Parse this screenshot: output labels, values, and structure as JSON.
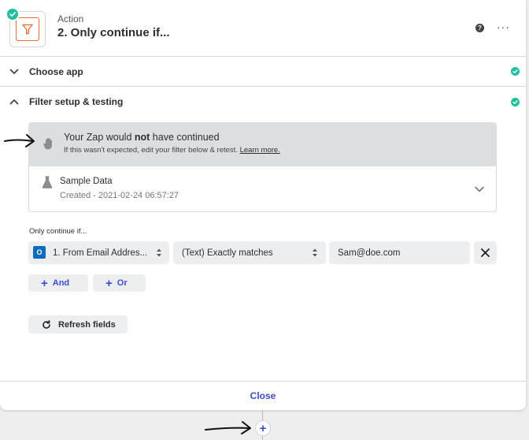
{
  "header": {
    "step_kind": "Action",
    "step_title": "2. Only continue if...",
    "help_glyph": "?",
    "more_glyph": "···"
  },
  "sections": [
    {
      "label": "Choose app",
      "expanded": false,
      "complete": true
    },
    {
      "label": "Filter setup & testing",
      "expanded": true,
      "complete": true
    }
  ],
  "alert": {
    "title_prefix": "Your Zap would ",
    "title_emphasis": "not",
    "title_suffix": " have continued",
    "subtitle": "If this wasn't expected, edit your filter below & retest.",
    "learn_more": "Learn more."
  },
  "sample": {
    "title": "Sample Data",
    "created": "Created - 2021-02-24 06:57:27"
  },
  "filter": {
    "label": "Only continue if...",
    "field_icon_glyph": "O",
    "field": "1. From Email Addres...",
    "condition": "(Text) Exactly matches",
    "value": "Sam@doe.com",
    "and_label": "And",
    "or_label": "Or"
  },
  "refresh_label": "Refresh fields",
  "footer": {
    "close_label": "Close"
  },
  "add_step_glyph": "+",
  "colors": {
    "accent": "#3d4bd3",
    "success": "#1fbf9e",
    "filter_brand": "#e86a2f",
    "alert_bg": "#dcdfe2"
  }
}
